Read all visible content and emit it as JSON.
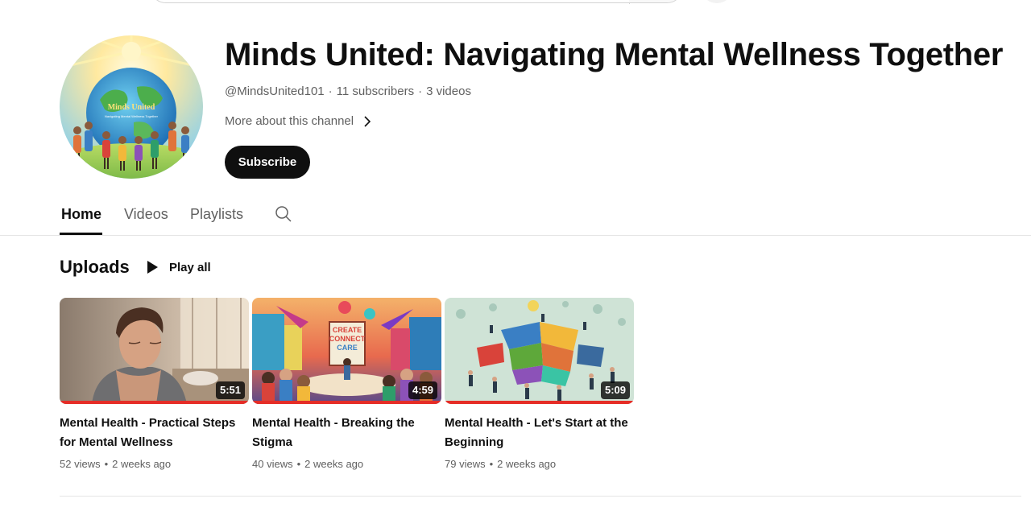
{
  "channel": {
    "name": "Minds United: Navigating Mental Wellness Together",
    "handle": "@MindsUnited101",
    "subscribers": "11 subscribers",
    "video_count": "3 videos",
    "meta_separator": "·",
    "more_about": "More about this channel",
    "subscribe_label": "Subscribe",
    "avatar_text_line1": "Minds United",
    "avatar_text_line2": "Navigating Mental Wellness Together"
  },
  "tabs": [
    {
      "label": "Home",
      "active": true
    },
    {
      "label": "Videos",
      "active": false
    },
    {
      "label": "Playlists",
      "active": false
    }
  ],
  "uploads": {
    "title": "Uploads",
    "play_all_label": "Play all",
    "videos": [
      {
        "title": "Mental Health - Practical Steps for Mental Wellness",
        "duration": "5:51",
        "views": "52 views",
        "age": "2 weeks ago",
        "watched_fraction": 1.0
      },
      {
        "title": "Mental Health - Breaking the Stigma",
        "duration": "4:59",
        "views": "40 views",
        "age": "2 weeks ago",
        "watched_fraction": 1.0,
        "thumb_sign_lines": [
          "CREATE",
          "CONNECT",
          "CARE"
        ]
      },
      {
        "title": "Mental Health - Let's Start at the Beginning",
        "duration": "5:09",
        "views": "79 views",
        "age": "2 weeks ago",
        "watched_fraction": 1.0
      }
    ]
  },
  "colors": {
    "text_primary": "#0f0f0f",
    "text_secondary": "#606060",
    "subscribe_bg": "#0f0f0f",
    "progress_red": "#e52d27",
    "divider": "#e5e5e5"
  },
  "icons": [
    "chevron-right-icon",
    "search-icon",
    "play-icon",
    "mic-icon"
  ]
}
